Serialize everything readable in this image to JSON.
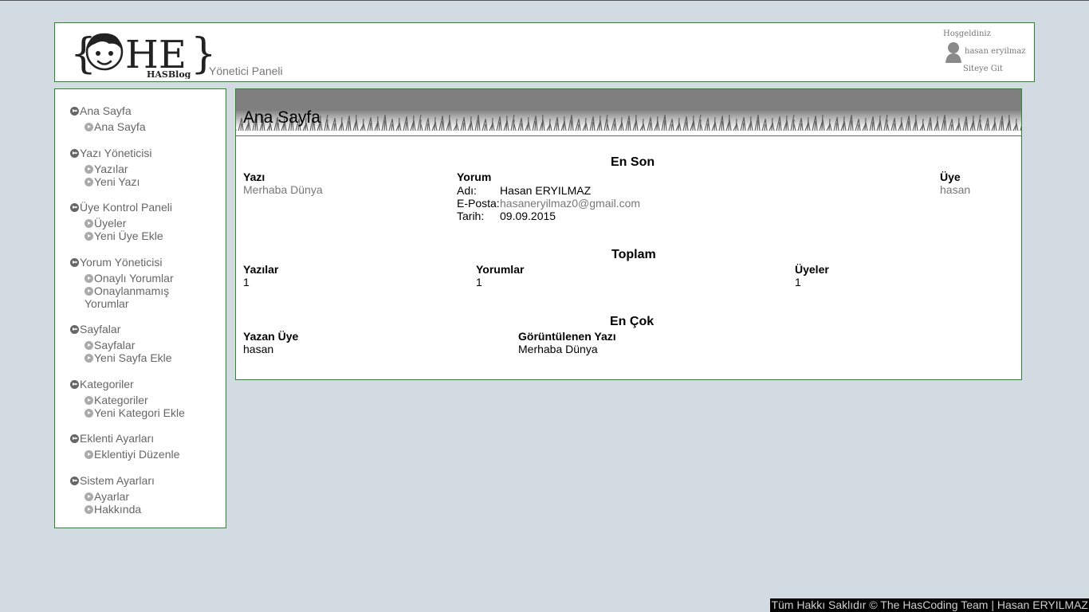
{
  "header": {
    "logo_letters": "HE",
    "logo_badge": "HAS",
    "logo_sub": "HASBlog",
    "panel_title": "Yönetici Paneli",
    "welcome": "Hoşgeldiniz",
    "username": "hasan eryilmaz",
    "site_link": "Siteye Git"
  },
  "sidebar": {
    "groups": [
      {
        "title": "Ana Sayfa",
        "items": [
          "Ana Sayfa"
        ]
      },
      {
        "title": "Yazı Yöneticisi",
        "items": [
          "Yazılar",
          "Yeni Yazı"
        ]
      },
      {
        "title": "Üye Kontrol Paneli",
        "items": [
          "Üyeler",
          "Yeni Üye Ekle"
        ]
      },
      {
        "title": "Yorum Yöneticisi",
        "items": [
          "Onaylı Yorumlar",
          "Onaylanmamış Yorumlar"
        ]
      },
      {
        "title": "Sayfalar",
        "items": [
          "Sayfalar",
          "Yeni Sayfa Ekle"
        ]
      },
      {
        "title": "Kategoriler",
        "items": [
          "Kategoriler",
          "Yeni Kategori Ekle"
        ]
      },
      {
        "title": "Eklenti Ayarları",
        "items": [
          "Eklentiyi Düzenle"
        ]
      },
      {
        "title": "Sistem Ayarları",
        "items": [
          "Ayarlar",
          "Hakkında"
        ]
      }
    ]
  },
  "main": {
    "title": "Ana Sayfa",
    "latest": {
      "title": "En Son",
      "post_header": "Yazı",
      "post_value": "Merhaba Dünya",
      "comment_header": "Yorum",
      "name_label": "Adı:",
      "name_value": "Hasan ERYILMAZ",
      "email_label": "E-Posta:",
      "email_value": "hasaneryilmaz0@gmail.com",
      "date_label": "Tarih:",
      "date_value": "09.09.2015",
      "member_header": "Üye",
      "member_value": "hasan"
    },
    "totals": {
      "title": "Toplam",
      "posts_header": "Yazılar",
      "posts_value": "1",
      "comments_header": "Yorumlar",
      "comments_value": "1",
      "members_header": "Üyeler",
      "members_value": "1"
    },
    "most": {
      "title": "En Çok",
      "writer_header": "Yazan Üye",
      "writer_value": "hasan",
      "viewed_header": "Görüntülenen Yazı",
      "viewed_value": "Merhaba Dünya"
    }
  },
  "footer": {
    "text": "Tüm Hakkı Saklıdır © The HasCoding Team | Hasan ERYILMAZ"
  },
  "colors": {
    "background": "#d2dae2",
    "border": "#2a8a2a",
    "header_band": "#7f7f7f",
    "muted_text": "#777777",
    "footer_bg": "#000000"
  },
  "icons": {
    "menu_group": "double-chevron-circle-icon",
    "menu_item": "chevron-circle-icon",
    "user": "user-silhouette-icon"
  }
}
